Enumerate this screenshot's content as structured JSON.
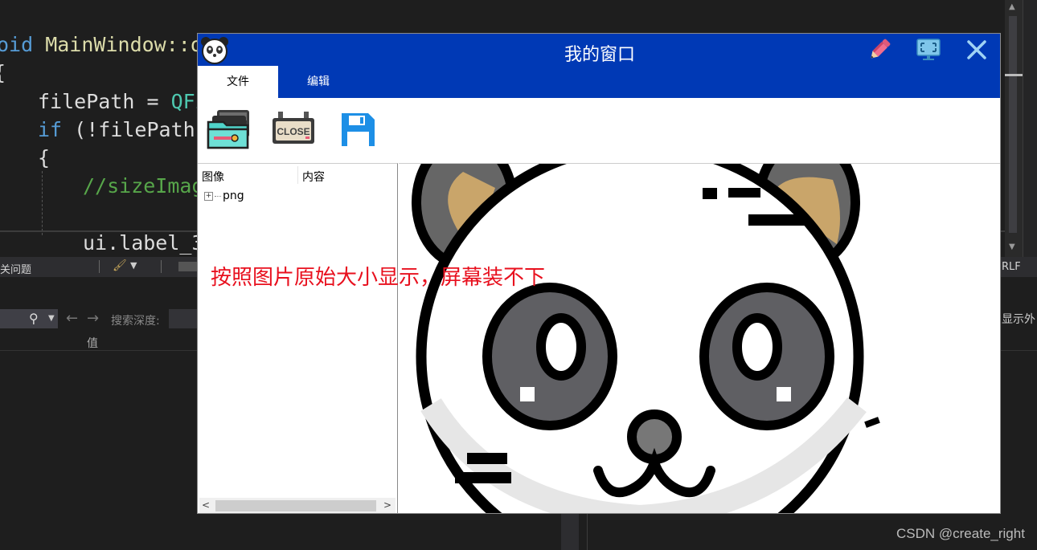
{
  "ide": {
    "code_lines": [
      {
        "prefix": "",
        "kw": "oid",
        "text": " MainWindow::o"
      },
      {
        "text": "{"
      },
      {
        "text": "filePath = ",
        "ty": "QFi"
      },
      {
        "kw": "if",
        "text": " (!filePath."
      },
      {
        "text": "{"
      },
      {
        "cm": "//sizeImag"
      },
      {
        "text": "ui.label_3"
      }
    ],
    "statusbar": {
      "issues_label": "关问题",
      "line_ending": "RLF"
    },
    "toolbar": {
      "search_depth_label": "搜索深度:",
      "value_column": "值",
      "show_external": "显示外"
    },
    "watermark": "CSDN @create_right"
  },
  "app": {
    "title": "我的窗口",
    "title_buttons": [
      "pencil-icon",
      "fullscreen-icon",
      "close-icon"
    ],
    "tabs": [
      {
        "label": "文件",
        "active": true
      },
      {
        "label": "编辑",
        "active": false
      }
    ],
    "ribbon_buttons": [
      "open-folder-icon",
      "close-sign-icon",
      "save-icon"
    ],
    "tree": {
      "columns": [
        "图像",
        "内容"
      ],
      "rows": [
        {
          "label": "png"
        }
      ]
    },
    "annotation": "按照图片原始大小显示，屏幕装不下",
    "colors": {
      "title_bar": "#0039b5",
      "annotation": "#e8101e"
    }
  }
}
